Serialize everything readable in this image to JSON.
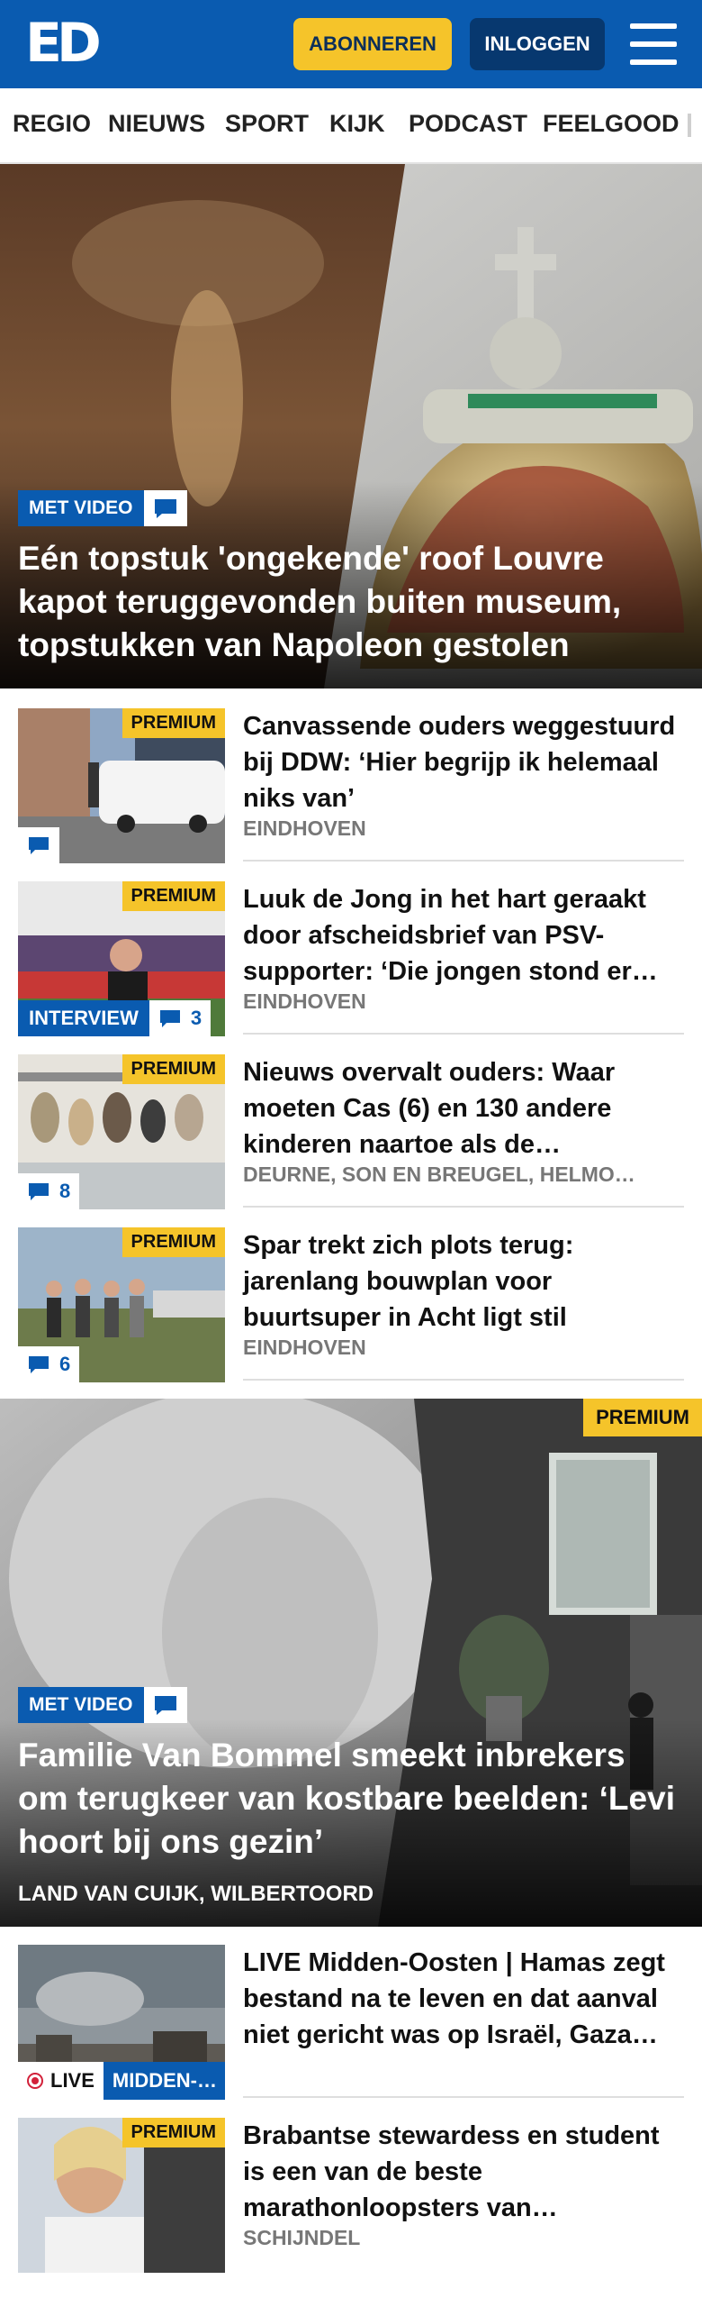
{
  "header": {
    "logo": "ED",
    "subscribe_label": "ABONNEREN",
    "login_label": "INLOGGEN",
    "menu_icon": "hamburger-icon"
  },
  "nav": {
    "items": [
      "REGIO",
      "NIEUWS",
      "SPORT",
      "KIJK",
      "PODCAST",
      "FEELGOOD"
    ]
  },
  "hero1": {
    "badge": "MET VIDEO",
    "title": "Eén topstuk 'ongekende' roof Louvre kapot teruggevonden buiten museum, topstukken van Napoleon gestolen"
  },
  "articles": [
    {
      "premium": "PREMIUM",
      "title": "Canvassende ouders wegge­stuurd bij DDW: ‘Hier begrijp ik helemaal niks van’",
      "location": "EINDHOVEN",
      "comments": ""
    },
    {
      "premium": "PREMIUM",
      "badge": "INTERVIEW",
      "title": "Luuk de Jong in het hart geraakt door afscheidsbrief van PSV-supporter: ‘Die jongen stond er…",
      "location": "EINDHOVEN",
      "comments": "3"
    },
    {
      "premium": "PREMIUM",
      "title": "Nieuws overvalt ouders: Waar moeten Cas (6) en 130 andere kinderen naartoe als de…",
      "location": "DEURNE, SON EN BREUGEL, HELMO…",
      "comments": "8"
    },
    {
      "premium": "PREMIUM",
      "title": "Spar trekt zich plots terug: jarenlang bouwplan voor buurtsuper in Acht ligt stil",
      "location": "EINDHOVEN",
      "comments": "6"
    }
  ],
  "hero2": {
    "premium": "PREMIUM",
    "badge": "MET VIDEO",
    "title": "Familie Van Bommel smeekt inbrekers om terugkeer van kostbare beelden: ‘Levi hoort bij ons gezin’",
    "location": "LAND VAN CUIJK, WILBERTOORD"
  },
  "live_article": {
    "live_label": "LIVE",
    "topic": "MIDDEN-…",
    "title": "LIVE Midden-Oosten | Hamas zegt bestand na te leven en dat aanval niet gericht was op Israël, Gaza…"
  },
  "last_article": {
    "premium": "PREMIUM",
    "title": "Brabantse stewardess en student is een van de beste marathonloopsters van…",
    "location": "SCHIJNDEL"
  }
}
